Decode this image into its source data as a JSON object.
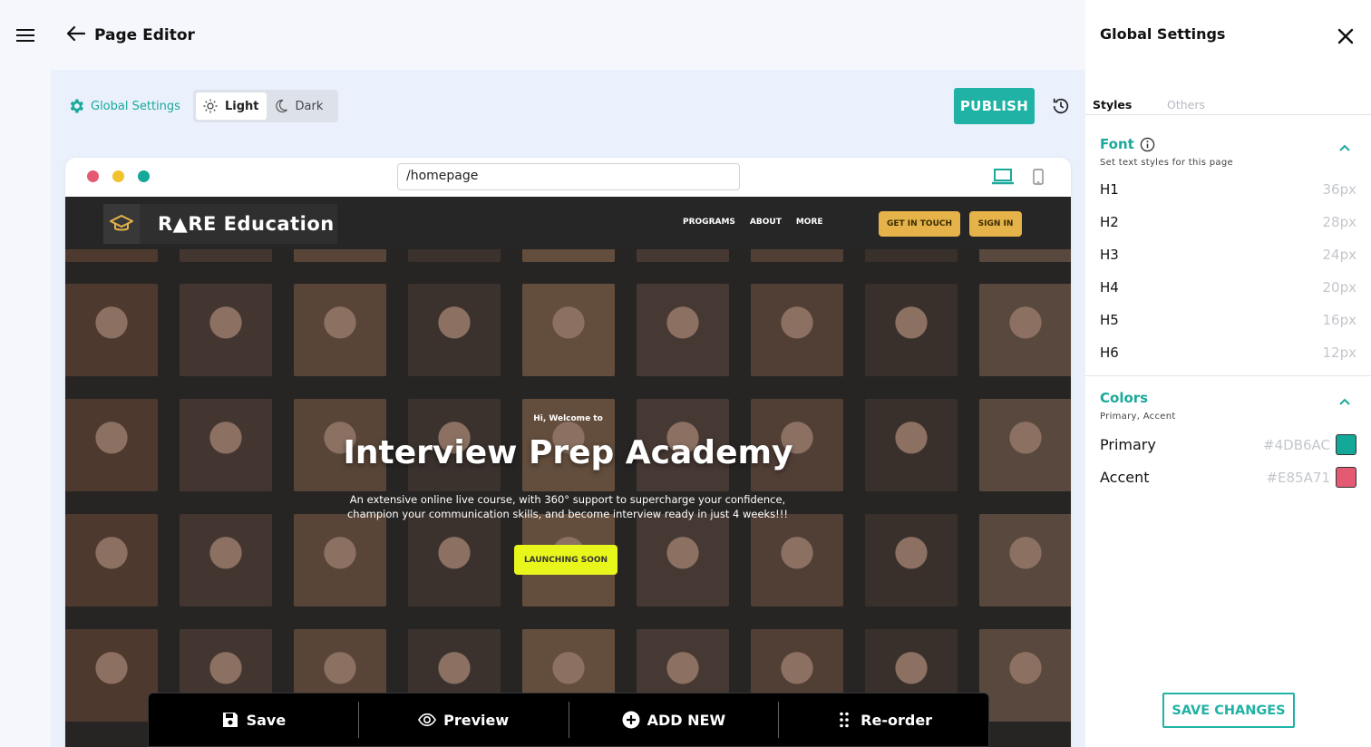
{
  "header": {
    "title": "Page Editor"
  },
  "toolbar": {
    "global_settings_label": "Global Settings",
    "theme": {
      "light": "Light",
      "dark": "Dark",
      "selected": "Light"
    },
    "publish_label": "PUBLISH"
  },
  "preview": {
    "url": "/homepage",
    "window_dot_colors": [
      "#e35a72",
      "#f2c12e",
      "#14a899"
    ],
    "site": {
      "brand": "R▲RE Education",
      "nav": [
        "PROGRAMS",
        "ABOUT",
        "MORE"
      ],
      "get_in_touch": "GET IN TOUCH",
      "sign_in": "SIGN IN",
      "pre_title": "Hi, Welcome to",
      "title": "Interview Prep Academy",
      "description": "An extensive online live course, with 360° support to supercharge your confidence, champion your communication skills, and become interview ready in just 4 weeks!!!",
      "cta": "LAUNCHING SOON"
    }
  },
  "action_bar": {
    "save": "Save",
    "preview": "Preview",
    "add_new": "ADD NEW",
    "reorder": "Re-order"
  },
  "panel": {
    "title": "Global Settings",
    "tabs": [
      "Styles",
      "Others"
    ],
    "active_tab": "Styles",
    "font": {
      "title": "Font",
      "subtitle": "Set text styles for this page",
      "rows": [
        {
          "label": "H1",
          "value": "36px"
        },
        {
          "label": "H2",
          "value": "28px"
        },
        {
          "label": "H3",
          "value": "24px"
        },
        {
          "label": "H4",
          "value": "20px"
        },
        {
          "label": "H5",
          "value": "16px"
        },
        {
          "label": "H6",
          "value": "12px"
        }
      ]
    },
    "colors": {
      "title": "Colors",
      "subtitle": "Primary, Accent",
      "primary": {
        "label": "Primary",
        "value": "#4DB6AC"
      },
      "accent": {
        "label": "Accent",
        "value": "#E85A71"
      }
    },
    "save_changes": "SAVE CHANGES"
  },
  "colors": {
    "teal": "#20b2a4",
    "cta_yellow": "#e8f61c",
    "nav_button": "#e6b24a"
  }
}
